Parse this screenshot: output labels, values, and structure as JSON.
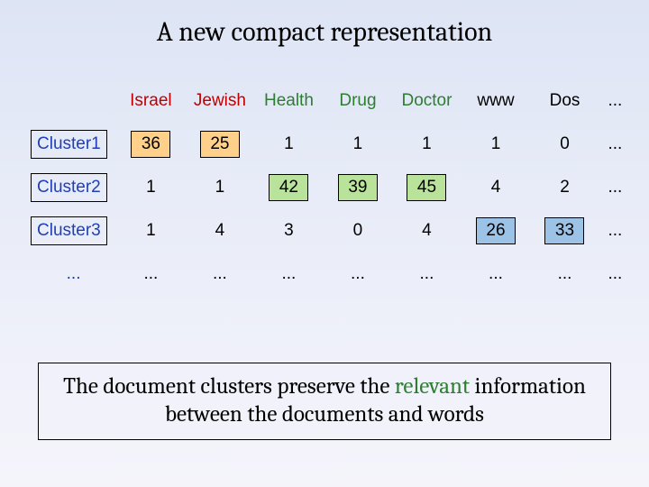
{
  "title": "A new compact representation",
  "chart_data": {
    "type": "table",
    "columns": [
      "Israel",
      "Jewish",
      "Health",
      "Drug",
      "Doctor",
      "www",
      "Dos",
      "..."
    ],
    "rows": [
      {
        "label": "Cluster1",
        "values": [
          "36",
          "25",
          "1",
          "1",
          "1",
          "1",
          "0",
          "..."
        ],
        "highlight": [
          0,
          1
        ],
        "hl_class": "hl-org"
      },
      {
        "label": "Cluster2",
        "values": [
          "1",
          "1",
          "42",
          "39",
          "45",
          "4",
          "2",
          "..."
        ],
        "highlight": [
          2,
          3,
          4
        ],
        "hl_class": "hl-grn"
      },
      {
        "label": "Cluster3",
        "values": [
          "1",
          "4",
          "3",
          "0",
          "4",
          "26",
          "33",
          "..."
        ],
        "highlight": [
          5,
          6
        ],
        "hl_class": "hl-blu"
      },
      {
        "label": "...",
        "values": [
          "...",
          "...",
          "...",
          "...",
          "...",
          "...",
          "...",
          "..."
        ],
        "highlight": [],
        "hl_class": ""
      }
    ],
    "column_groups": {
      "Israel": "red",
      "Jewish": "red",
      "Health": "grn",
      "Drug": "grn",
      "Doctor": "grn",
      "www": "",
      "Dos": "",
      "...": ""
    }
  },
  "caption_pre": "The document clusters preserve the ",
  "caption_kw": "relevant",
  "caption_post": " information between the documents and words"
}
